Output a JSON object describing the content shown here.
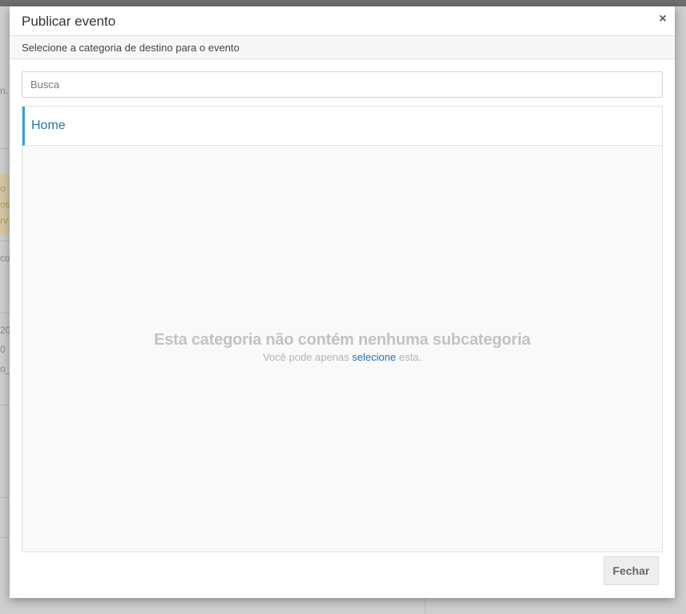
{
  "modal": {
    "title": "Publicar evento",
    "close_icon": "×",
    "subtitle": "Selecione a categoria de destino para o evento",
    "search": {
      "placeholder": "Busca",
      "value": ""
    },
    "breadcrumb": [
      {
        "label": "Home"
      }
    ],
    "empty_state": {
      "title": "Esta categoria não contém nenhuma subcategoria",
      "subtitle_before": "Você pode apenas",
      "subtitle_link": "selecione",
      "subtitle_after": "esta."
    },
    "close_button_label": "Fechar"
  },
  "background": {
    "fragments": [
      "n.",
      "o",
      "os",
      "rv",
      "co",
      "20",
      "0",
      "o_"
    ]
  },
  "colors": {
    "accent": "#3a9fd5",
    "link": "#2178b0",
    "overlay": "#7c7c7c"
  }
}
